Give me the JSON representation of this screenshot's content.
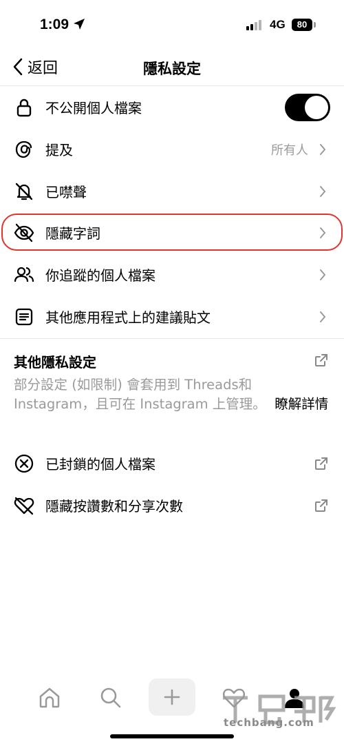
{
  "status_bar": {
    "time": "1:09",
    "network": "4G",
    "battery": "80"
  },
  "nav": {
    "back_label": "返回",
    "title": "隱私設定"
  },
  "rows": [
    {
      "label": "不公開個人檔案",
      "toggle_on": true
    },
    {
      "label": "提及",
      "value": "所有人"
    },
    {
      "label": "已噤聲"
    },
    {
      "label": "隱藏字詞",
      "highlighted": true
    },
    {
      "label": "你追蹤的個人檔案"
    },
    {
      "label": "其他應用程式上的建議貼文"
    }
  ],
  "other_section": {
    "title": "其他隱私設定",
    "description": "部分設定 (如限制) 會套用到 Threads和 Instagram，且可在 Instagram 上管理。",
    "learn_more": "瞭解詳情",
    "items": [
      {
        "label": "已封鎖的個人檔案"
      },
      {
        "label": "隱藏按讚數和分享次數"
      }
    ]
  },
  "tabbar": {
    "tabs": [
      "home-icon",
      "search-icon",
      "plus-icon",
      "heart-icon",
      "profile-icon"
    ]
  },
  "watermark": {
    "text": "techbang.com"
  },
  "colors": {
    "highlight": "#e2322d",
    "secondary_text": "#9a9a9a",
    "toggle": "#000000"
  }
}
